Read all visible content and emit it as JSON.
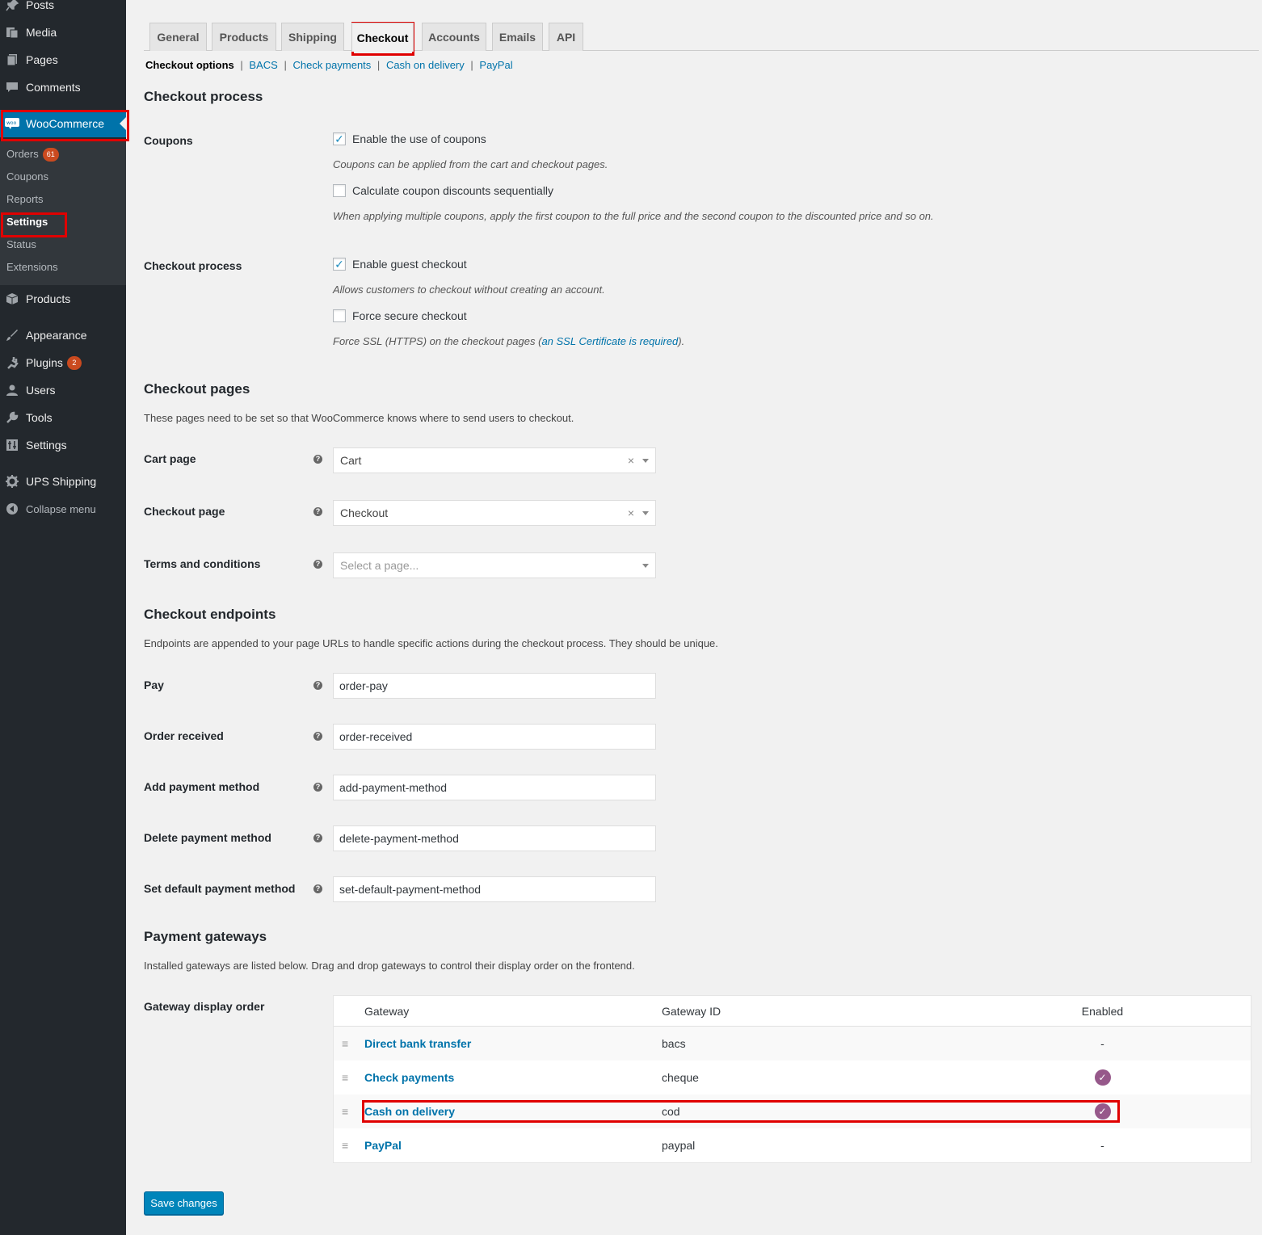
{
  "sidebar": {
    "menu": [
      {
        "label": "Posts",
        "icon": "pushpin-icon"
      },
      {
        "label": "Media",
        "icon": "media-icon"
      },
      {
        "label": "Pages",
        "icon": "pages-icon"
      },
      {
        "label": "Comments",
        "icon": "comments-icon"
      },
      {
        "label": "WooCommerce",
        "icon": "woocommerce-icon"
      },
      {
        "label": "Products",
        "icon": "products-icon"
      },
      {
        "label": "Appearance",
        "icon": "appearance-icon"
      },
      {
        "label": "Plugins",
        "icon": "plugins-icon",
        "badge": "2"
      },
      {
        "label": "Users",
        "icon": "users-icon"
      },
      {
        "label": "Tools",
        "icon": "tools-icon"
      },
      {
        "label": "Settings",
        "icon": "settings-icon"
      },
      {
        "label": "UPS Shipping",
        "icon": "gear-icon"
      },
      {
        "label": "Collapse menu",
        "icon": "collapse-icon"
      }
    ],
    "submenu": [
      {
        "label": "Orders",
        "badge": "61"
      },
      {
        "label": "Coupons"
      },
      {
        "label": "Reports"
      },
      {
        "label": "Settings"
      },
      {
        "label": "Status"
      },
      {
        "label": "Extensions"
      }
    ]
  },
  "tabs": [
    "General",
    "Products",
    "Shipping",
    "Checkout",
    "Accounts",
    "Emails",
    "API"
  ],
  "subnav": {
    "current": "Checkout options",
    "links": [
      "BACS",
      "Check payments",
      "Cash on delivery",
      "PayPal"
    ],
    "sep": "|"
  },
  "checkout_process": {
    "title": "Checkout process",
    "coupons_label": "Coupons",
    "coupons_enable": "Enable the use of coupons",
    "coupons_enable_desc": "Coupons can be applied from the cart and checkout pages.",
    "coupons_seq": "Calculate coupon discounts sequentially",
    "coupons_seq_desc": "When applying multiple coupons, apply the first coupon to the full price and the second coupon to the discounted price and so on.",
    "process_label": "Checkout process",
    "guest": "Enable guest checkout",
    "guest_desc": "Allows customers to checkout without creating an account.",
    "secure": "Force secure checkout",
    "secure_desc_pre": "Force SSL (HTTPS) on the checkout pages (",
    "secure_desc_link": "an SSL Certificate is required",
    "secure_desc_post": ").",
    "check_mark": "✓"
  },
  "checkout_pages": {
    "title": "Checkout pages",
    "desc": "These pages need to be set so that WooCommerce knows where to send users to checkout.",
    "cart_label": "Cart page",
    "cart_value": "Cart",
    "checkout_label": "Checkout page",
    "checkout_value": "Checkout",
    "terms_label": "Terms and conditions",
    "terms_placeholder": "Select a page...",
    "clear": "×",
    "help": "?"
  },
  "endpoints": {
    "title": "Checkout endpoints",
    "desc": "Endpoints are appended to your page URLs to handle specific actions during the checkout process. They should be unique.",
    "rows": [
      {
        "label": "Pay",
        "value": "order-pay"
      },
      {
        "label": "Order received",
        "value": "order-received"
      },
      {
        "label": "Add payment method",
        "value": "add-payment-method"
      },
      {
        "label": "Delete payment method",
        "value": "delete-payment-method"
      },
      {
        "label": "Set default payment method",
        "value": "set-default-payment-method"
      }
    ]
  },
  "gateways": {
    "title": "Payment gateways",
    "desc": "Installed gateways are listed below. Drag and drop gateways to control their display order on the frontend.",
    "order_label": "Gateway display order",
    "headers": {
      "gateway": "Gateway",
      "id": "Gateway ID",
      "enabled": "Enabled"
    },
    "rows": [
      {
        "name": "Direct bank transfer",
        "id": "bacs",
        "enabled": "-"
      },
      {
        "name": "Check payments",
        "id": "cheque",
        "enabled": "✓"
      },
      {
        "name": "Cash on delivery",
        "id": "cod",
        "enabled": "✓"
      },
      {
        "name": "PayPal",
        "id": "paypal",
        "enabled": "-"
      }
    ],
    "drag": "≡"
  },
  "save_label": "Save changes",
  "colors": {
    "accent": "#0073aa",
    "highlight": "#e00000",
    "woo_purple": "#96588a"
  }
}
